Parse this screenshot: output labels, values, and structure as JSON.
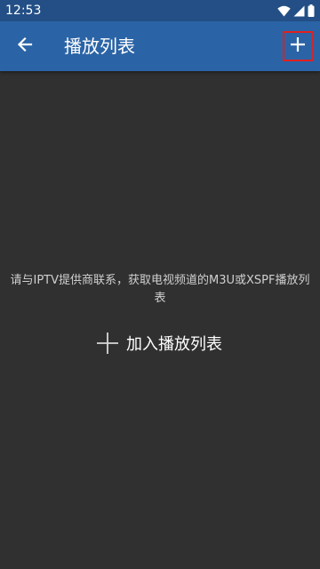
{
  "status_bar": {
    "time": "12:53",
    "icons": [
      "wifi-icon",
      "signal-icon",
      "battery-icon"
    ]
  },
  "app_bar": {
    "title": "播放列表",
    "back_icon": "arrow-left-icon",
    "add_icon": "plus-icon",
    "background_color": "#2b64a6"
  },
  "empty_state": {
    "message": "请与IPTV提供商联系，获取电视频道的M3U或XSPF播放列表",
    "add_button_label": "加入播放列表",
    "add_button_icon": "plus-icon"
  }
}
